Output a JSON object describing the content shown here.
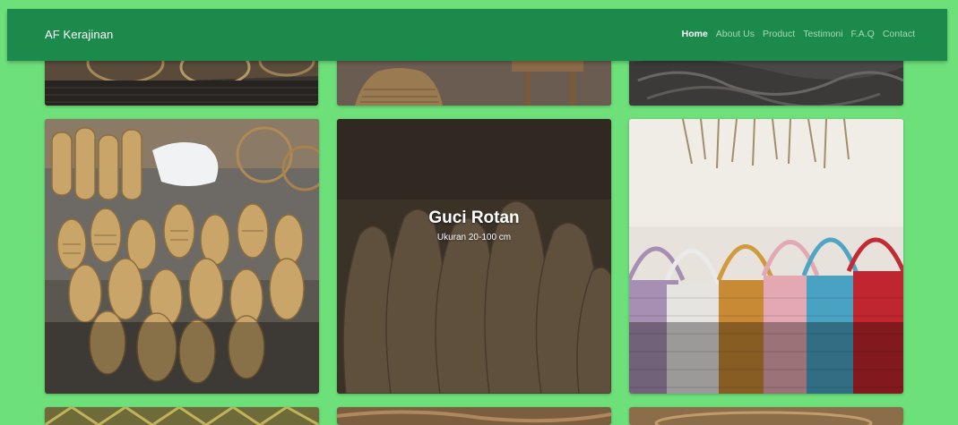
{
  "header": {
    "brand": "AF Kerajinan",
    "nav": [
      "Home",
      "About Us",
      "Product",
      "Testimoni",
      "F.A.Q",
      "Contact"
    ],
    "active_nav": "Home"
  },
  "gallery": {
    "featured": {
      "title": "Guci Rotan",
      "subtitle": "Ukuran 20-100 cm"
    }
  },
  "colors": {
    "page_background": "#6ee07a",
    "navbar": "#1c8a4a",
    "nav_text": "#a8d8b4",
    "nav_active": "#ffffff"
  }
}
